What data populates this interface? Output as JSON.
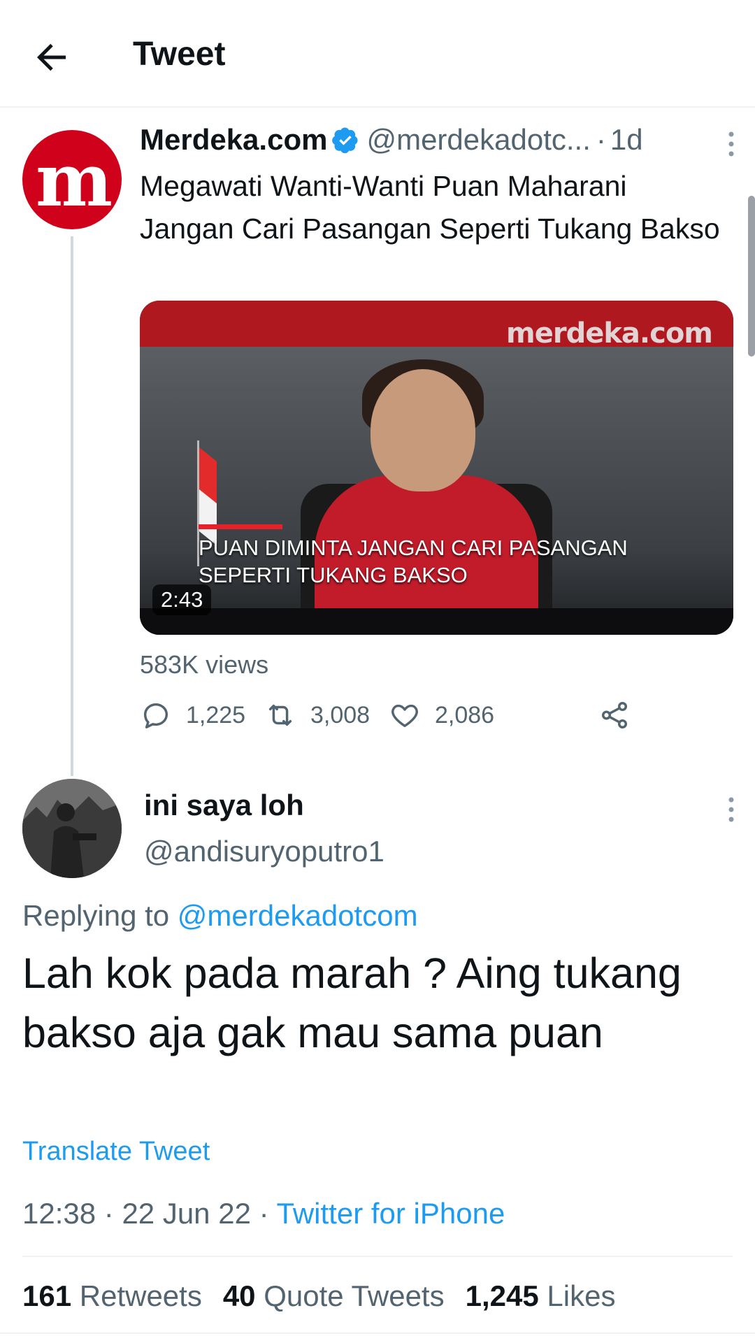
{
  "header": {
    "title": "Tweet"
  },
  "parent_tweet": {
    "avatar_letter": "m",
    "name": "Merdeka.com",
    "handle": "@merdekadotc...",
    "dot": "·",
    "time": "1d",
    "text": "Megawati Wanti-Wanti Puan Maharani Jangan Cari Pasangan Seperti Tukang Bakso",
    "video": {
      "watermark": "merdeka.com",
      "caption": "PUAN DIMINTA JANGAN CARI PASANGAN SEPERTI TUKANG BAKSO",
      "duration": "2:43"
    },
    "views": "583K views",
    "actions": {
      "replies": "1,225",
      "retweets": "3,008",
      "likes": "2,086"
    }
  },
  "reply_tweet": {
    "name": "ini saya loh",
    "handle": "@andisuryoputro1",
    "replying_prefix": "Replying to ",
    "replying_mention": "@merdekadotcom",
    "text": "Lah kok pada marah ? Aing tukang bakso aja gak mau sama puan",
    "translate": "Translate Tweet",
    "time": "12:38",
    "date": "22 Jun 22",
    "sep": " · ",
    "source": "Twitter for iPhone",
    "stats": {
      "retweets_count": "161",
      "retweets_label": "Retweets",
      "quotes_count": "40",
      "quotes_label": "Quote Tweets",
      "likes_count": "1,245",
      "likes_label": "Likes"
    }
  },
  "colors": {
    "accent": "#1d9bf0",
    "brand_red": "#d0021b",
    "muted": "#536471"
  }
}
